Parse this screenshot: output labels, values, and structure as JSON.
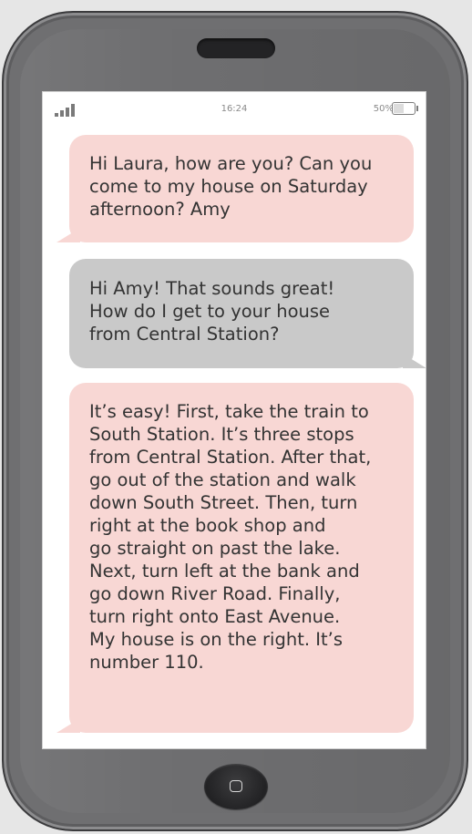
{
  "status_bar": {
    "time": "16:24",
    "battery_percent": "50%",
    "battery_level": 0.5,
    "signal_icon": "signal-bars-icon",
    "battery_icon": "battery-icon"
  },
  "messages": [
    {
      "sender": "Amy",
      "text": "Hi Laura, how are you? Can you\ncome to my house on Saturday\nafternoon? Amy"
    },
    {
      "sender": "Laura",
      "text": "Hi Amy! That sounds great!\nHow do I get to your house\nfrom Central Station?"
    },
    {
      "sender": "Amy",
      "text": "It’s easy! First, take the train to\nSouth Station. It’s three stops\nfrom Central Station. After that,\ngo out of the station and walk\ndown South Street. Then, turn\nright at the book shop and\ngo straight on past the lake.\nNext, turn left at the bank and\ngo down River Road. Finally,\nturn right onto East Avenue.\nMy house is on the right. It’s\nnumber 110."
    }
  ],
  "colors": {
    "incoming_bubble": "#f8d7d4",
    "outgoing_bubble": "#c9c9c9",
    "phone_body": "#6f6f71"
  },
  "home_button_icon": "home-square-icon"
}
